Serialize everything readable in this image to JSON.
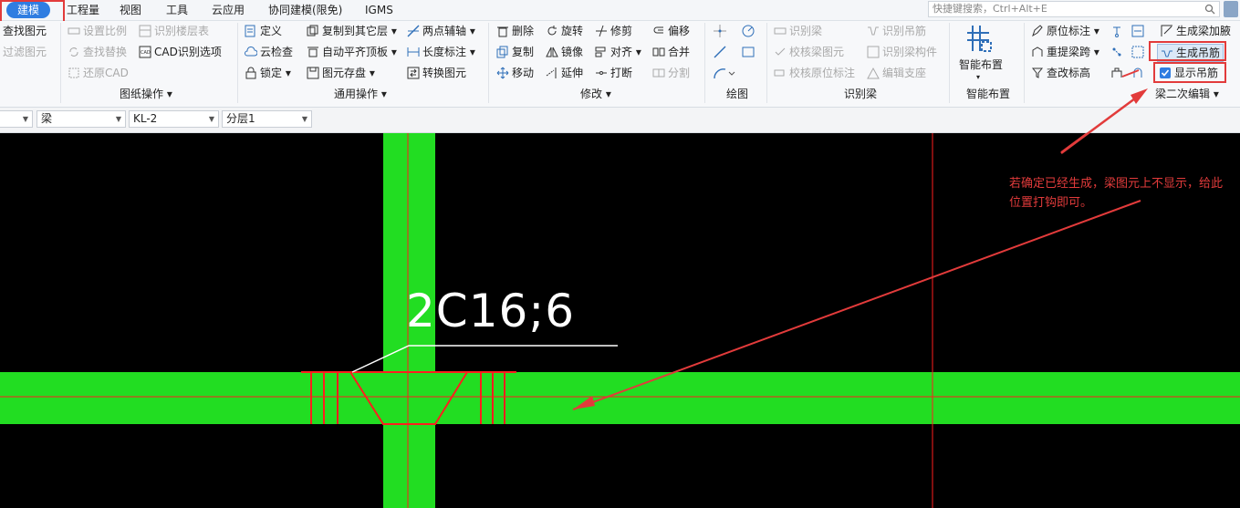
{
  "menu": {
    "active": "建模",
    "items": [
      "工程量",
      "视图",
      "工具",
      "云应用",
      "协同建模(限免)",
      "IGMS"
    ]
  },
  "search": {
    "placeholder": "快捷键搜索，Ctrl+Alt+E"
  },
  "ribbon": {
    "drawing_ops": {
      "label": "图纸操作",
      "col0": [
        "查找图元",
        "过滤图元"
      ],
      "items": [
        "设置比例",
        "识别楼层表",
        "查找替换",
        "CAD识别选项",
        "还原CAD"
      ]
    },
    "general_ops": {
      "label": "通用操作",
      "items": [
        "定义",
        "复制到其它层",
        "两点辅轴",
        "云检查",
        "自动平齐顶板",
        "长度标注",
        "锁定",
        "图元存盘",
        "转换图元"
      ]
    },
    "modify": {
      "label": "修改",
      "items": [
        "删除",
        "旋转",
        "修剪",
        "偏移",
        "复制",
        "镜像",
        "对齐",
        "合并",
        "移动",
        "延伸",
        "打断",
        "分割"
      ]
    },
    "draw": {
      "label": "绘图"
    },
    "recognize_beam": {
      "label": "识别梁",
      "items": [
        "识别梁",
        "识别吊筋",
        "校核梁图元",
        "识别梁构件",
        "校核原位标注",
        "编辑支座"
      ]
    },
    "smart_layout": {
      "label": "智能布置",
      "button": "智能布置"
    },
    "beam_edit": {
      "label": "梁二次编辑",
      "items": [
        "原位标注",
        "生成梁加腋",
        "重提梁跨",
        "生成吊筋",
        "查改标高",
        "显示吊筋"
      ]
    }
  },
  "props": {
    "combo0": "",
    "combo1": "梁",
    "combo2": "KL-2",
    "combo3": "分层1"
  },
  "canvas": {
    "rebar_label": "2C16;6",
    "annotation": "若确定已经生成，梁图元上不显示，给此位置打钩即可。"
  },
  "colors": {
    "beam": "#22dd22",
    "line": "#ff1e1e",
    "annotation": "#e23b3b",
    "accent": "#2f7de1"
  }
}
